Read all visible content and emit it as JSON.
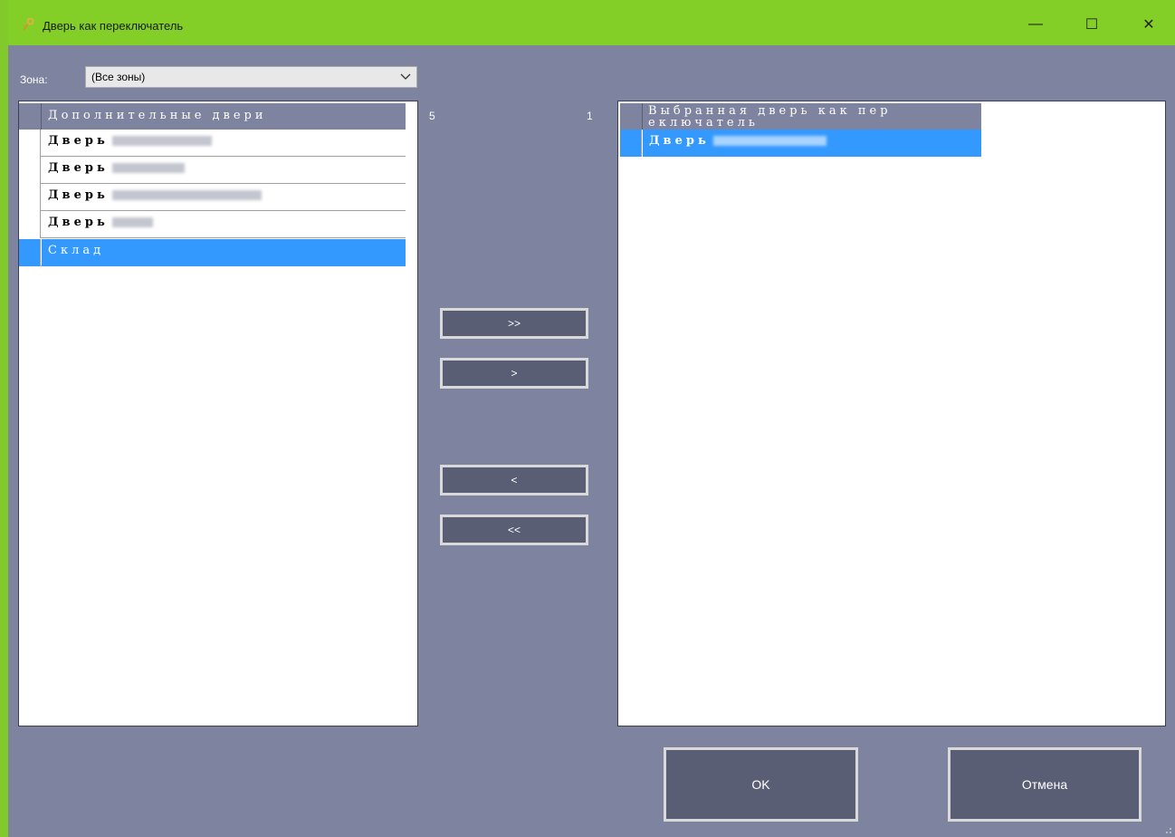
{
  "window": {
    "title": "Дверь как переключатель",
    "minimize_glyph": "—",
    "maximize_glyph": "☐",
    "close_glyph": "✕",
    "accent_color": "#83cf27"
  },
  "zone": {
    "label": "Зона:",
    "selected": "(Все зоны)"
  },
  "left_grid": {
    "header": "Дополнительные двери",
    "count": "5",
    "rows": [
      {
        "prefix": "Дверь"
      },
      {
        "prefix": "Дверь"
      },
      {
        "prefix": "Дверь"
      },
      {
        "prefix": "Дверь"
      },
      {
        "prefix": "Склад"
      }
    ],
    "selected_index": 4
  },
  "right_grid": {
    "header_line1": "Выбранная дверь как пер",
    "header_line2": "еключатель",
    "count": "1",
    "rows": [
      {
        "prefix": "Дверь"
      }
    ],
    "selected_index": 0
  },
  "move_buttons": {
    "add_all": ">>",
    "add_one": ">",
    "remove_one": "<",
    "remove_all": "<<"
  },
  "dialog_buttons": {
    "ok": "OK",
    "cancel": "Отмена"
  },
  "colors": {
    "selection": "#3399ff",
    "background": "#7e83a0",
    "button": "#5a5e75"
  }
}
